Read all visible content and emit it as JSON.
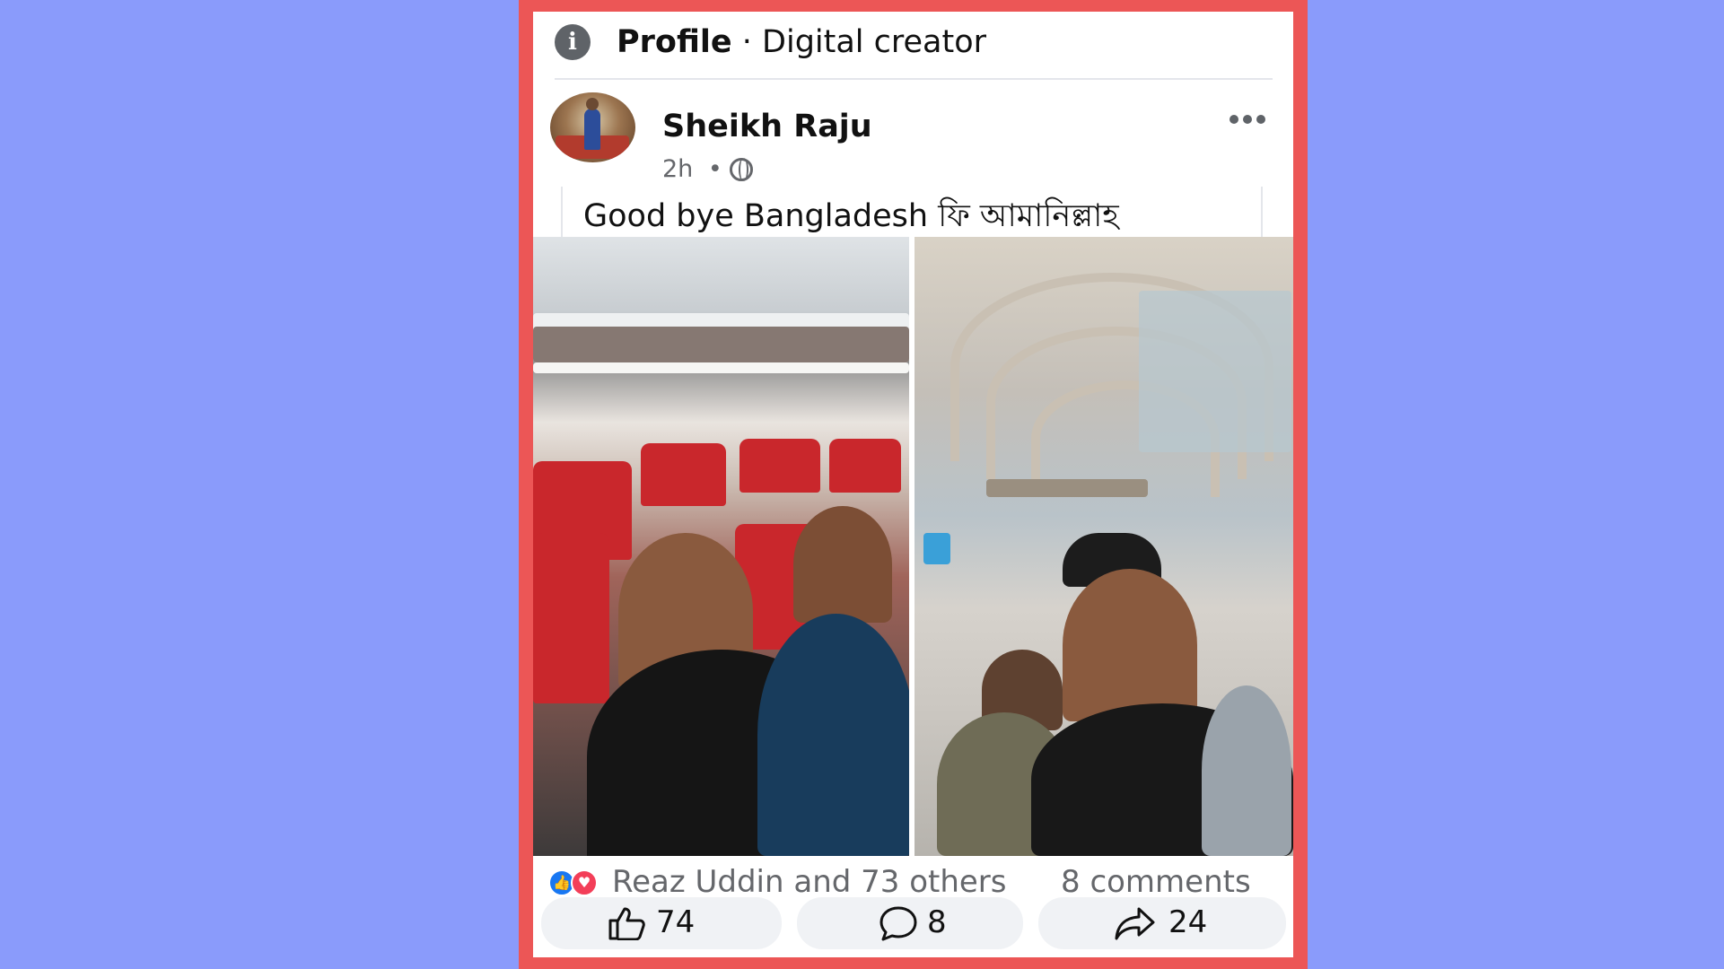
{
  "header": {
    "title_bold": "Profile",
    "title_rest": " · Digital creator"
  },
  "post": {
    "author": "Sheikh Raju",
    "time": "2h",
    "separator": "•",
    "text": "Good bye Bangladesh ফি আমানিল্লাহ"
  },
  "reactions": {
    "names": "Reaz Uddin and 73 others",
    "comments": "8 comments"
  },
  "actions": {
    "like_count": "74",
    "comment_count": "8",
    "share_count": "24"
  },
  "colors": {
    "background": "#8a9bfb",
    "frame": "#ec5656",
    "like": "#1877f2",
    "love": "#f33e58"
  },
  "icons": [
    "info-icon",
    "globe-icon",
    "more-icon",
    "like-icon",
    "love-icon",
    "thumb-icon",
    "comment-icon",
    "share-icon"
  ]
}
